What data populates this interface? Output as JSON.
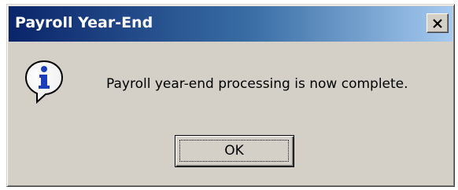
{
  "dialog": {
    "title": "Payroll Year-End",
    "message": "Payroll year-end processing is now complete.",
    "icon": "info-icon",
    "close_icon": "close-icon",
    "ok_label": "OK"
  },
  "colors": {
    "title_gradient_start": "#0a246a",
    "title_gradient_end": "#a6caf0",
    "face": "#d4d0c8",
    "icon_blue": "#1a3fb8"
  }
}
